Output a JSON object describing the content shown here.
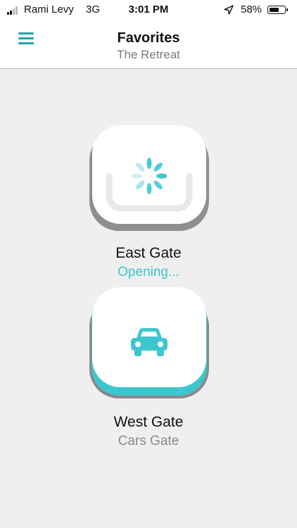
{
  "status_bar": {
    "carrier": "Rami Levy",
    "network": "3G",
    "time": "3:01 PM",
    "battery": "58%",
    "battery_level": 0.58,
    "signal_bars": 4,
    "signal_bars_filled": 2
  },
  "header": {
    "title": "Favorites",
    "subtitle": "The Retreat",
    "menu_icon": "hamburger-menu-icon"
  },
  "gates": [
    {
      "name": "East Gate",
      "status": "Opening...",
      "icon": "loading-spinner-icon",
      "status_color": "#3ec6cf"
    },
    {
      "name": "West Gate",
      "status": "Cars Gate",
      "icon": "car-icon",
      "status_color": "#8a8a8a"
    }
  ],
  "colors": {
    "accent": "#3ec6cf",
    "accent_dark": "#1fa5ad",
    "background": "#efefef",
    "header_background": "#ffffff"
  }
}
